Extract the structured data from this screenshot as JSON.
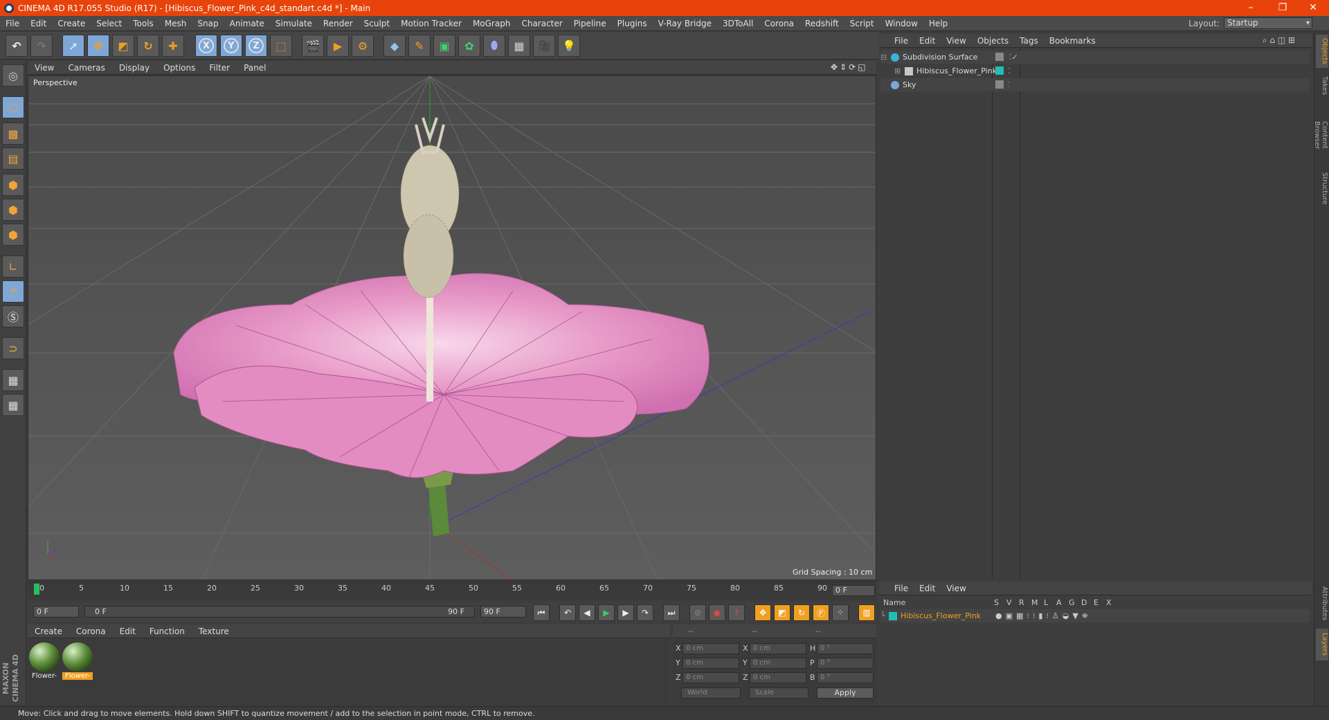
{
  "window": {
    "title": "CINEMA 4D R17.055 Studio (R17) - [Hibiscus_Flower_Pink_c4d_standart.c4d *] - Main",
    "minimize": "–",
    "restore": "❐",
    "close": "✕"
  },
  "menubar": [
    "File",
    "Edit",
    "Create",
    "Select",
    "Tools",
    "Mesh",
    "Snap",
    "Animate",
    "Simulate",
    "Render",
    "Sculpt",
    "Motion Tracker",
    "MoGraph",
    "Character",
    "Pipeline",
    "Plugins",
    "V-Ray Bridge",
    "3DToAll",
    "Corona",
    "Redshift",
    "Script",
    "Window",
    "Help"
  ],
  "layout": {
    "label": "Layout:",
    "value": "Startup"
  },
  "toolbar": {
    "x_label": "X",
    "y_label": "Y",
    "z_label": "Z"
  },
  "viewport": {
    "menu": [
      "View",
      "Cameras",
      "Display",
      "Options",
      "Filter",
      "Panel"
    ],
    "camera_label": "Perspective",
    "grid_spacing": "Grid Spacing : 10 cm"
  },
  "timeline": {
    "ticks": [
      "0",
      "5",
      "10",
      "15",
      "20",
      "25",
      "30",
      "35",
      "40",
      "45",
      "50",
      "55",
      "60",
      "65",
      "70",
      "75",
      "80",
      "85",
      "90"
    ],
    "current_frame": "0 F",
    "start_field": "0 F",
    "range_start": "0 F",
    "range_end": "90 F",
    "end_field": "90 F"
  },
  "material_manager": {
    "menu": [
      "Create",
      "Corona",
      "Edit",
      "Function",
      "Texture"
    ],
    "materials": [
      {
        "label": "Flower-",
        "selected": false
      },
      {
        "label": "Flower-",
        "selected": true
      }
    ]
  },
  "coordinates": {
    "head": [
      "--",
      "--",
      "--"
    ],
    "rows": [
      {
        "a": "X",
        "av": "0 cm",
        "b": "X",
        "bv": "0 cm",
        "c": "H",
        "cv": "0 °"
      },
      {
        "a": "Y",
        "av": "0 cm",
        "b": "Y",
        "bv": "0 cm",
        "c": "P",
        "cv": "0 °"
      },
      {
        "a": "Z",
        "av": "0 cm",
        "b": "Z",
        "bv": "0 cm",
        "c": "B",
        "cv": "0 °"
      }
    ],
    "space": "World",
    "mode": "Scale",
    "apply": "Apply"
  },
  "status": "Move: Click and drag to move elements. Hold down SHIFT to quantize movement / add to the selection in point mode, CTRL to remove.",
  "object_manager": {
    "menu": [
      "File",
      "Edit",
      "View",
      "Objects",
      "Tags",
      "Bookmarks"
    ],
    "objects": [
      {
        "name": "Subdivision Surface",
        "icon_color": "#3fb0d8"
      },
      {
        "name": "Hibiscus_Flower_Pink",
        "icon_color": "#c8c8c8"
      },
      {
        "name": "Sky",
        "icon_color": "#7aa7d8"
      }
    ]
  },
  "layer_manager": {
    "menu": [
      "File",
      "Edit",
      "View"
    ],
    "columns": [
      "Name",
      "S",
      "V",
      "R",
      "M",
      "L",
      "A",
      "G",
      "D",
      "E",
      "X"
    ],
    "layer_name": "Hibiscus_Flower_Pink",
    "layer_color": "#20c0b0"
  },
  "right_tabs": [
    "Objects",
    "Takes",
    "Content Browser",
    "Structure",
    "Attributes",
    "Layers"
  ],
  "brand": "MAXON CINEMA 4D",
  "colors": {
    "accent": "#f0a020",
    "titlebar": "#e8430b",
    "active_tool": "#7ea7d8"
  }
}
